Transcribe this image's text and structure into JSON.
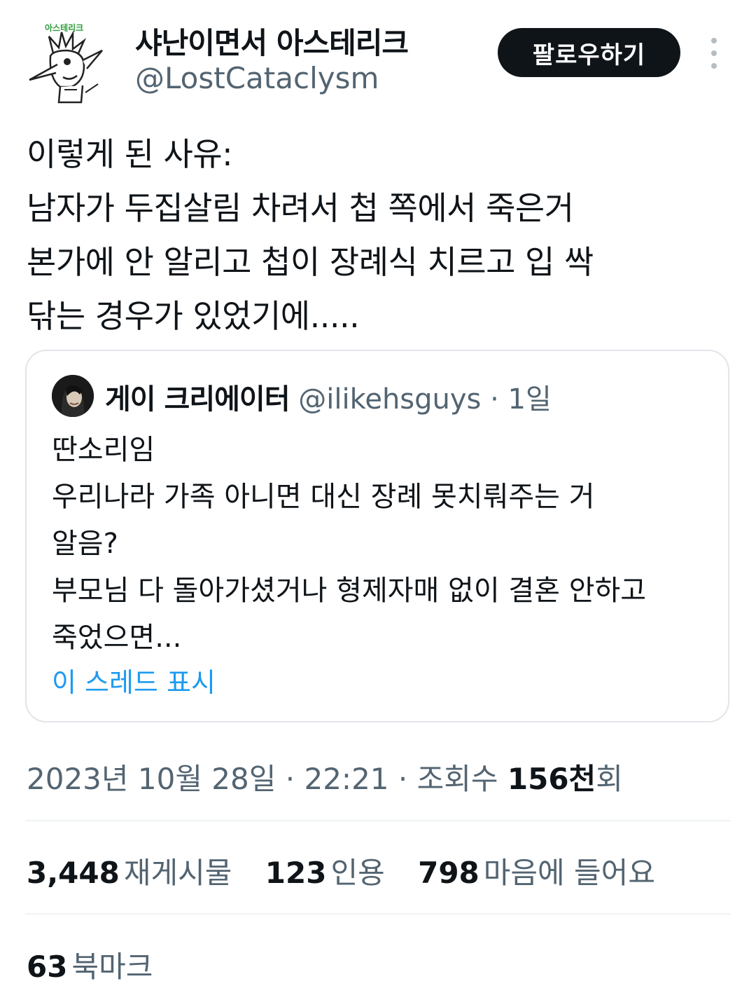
{
  "author": {
    "avatar_badge_text": "아스테리크",
    "display_name": "샤난이면서 아스테리크",
    "handle": "@LostCataclysm"
  },
  "follow_label": "팔로우하기",
  "more_icon": "more-vertical-icon",
  "tweet_lines": [
    "이렇게 된 사유:",
    "남자가 두집살림 차려서 첩 쪽에서 죽은거",
    "본가에 안 알리고 첩이 장례식 치르고 입 싹",
    "닦는 경우가 있었기에....."
  ],
  "quote": {
    "display_name": "게이 크리에이터",
    "handle": "@ilikehsguys",
    "separator": "·",
    "time": "1일",
    "lines": [
      "딴소리임",
      "우리나라 가족 아니면 대신 장례 못치뤄주는 거",
      "알음?",
      "부모님 다 돌아가셨거나 형제자매 없이 결혼 안하고",
      "죽었으면..."
    ],
    "show_thread": "이 스레드 표시"
  },
  "meta": {
    "date": "2023년 10월 28일",
    "sep1": "·",
    "time": "22:21",
    "sep2": "·",
    "views_label": "조회수",
    "views_value": "156천",
    "views_suffix": "회"
  },
  "stats": {
    "retweets_count": "3,448",
    "retweets_label": "재게시물",
    "quotes_count": "123",
    "quotes_label": "인용",
    "likes_count": "798",
    "likes_label": "마음에 들어요",
    "bookmarks_count": "63",
    "bookmarks_label": "북마크"
  },
  "colors": {
    "text": "#0f1419",
    "secondary": "#536471",
    "link": "#1d9bf0",
    "border": "#e1e5e9",
    "button_bg": "#0f1419",
    "badge_green": "#2e9b3a"
  }
}
